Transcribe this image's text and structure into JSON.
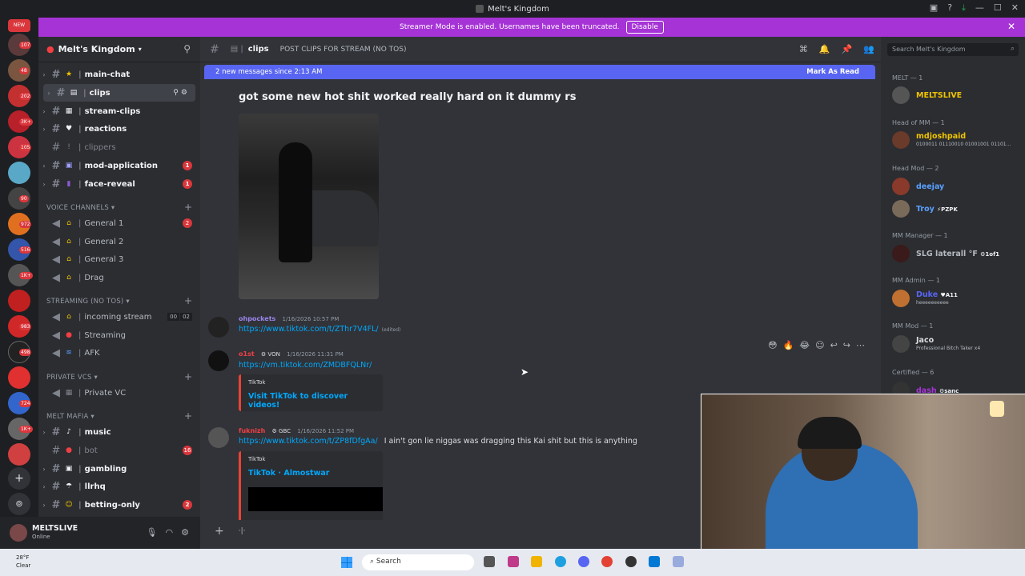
{
  "window": {
    "title": "Melt's Kingdom"
  },
  "banner": {
    "text": "Streamer Mode is enabled. Usernames have been truncated.",
    "disable_label": "Disable"
  },
  "servers": {
    "new_badge": "NEW",
    "badges": [
      "107",
      "48",
      "202",
      "3K+",
      "105",
      "90",
      "972",
      "516",
      "1K+",
      "983",
      "498",
      "724",
      "1K+"
    ]
  },
  "guild": {
    "name": "Melt's Kingdom"
  },
  "channels": [
    {
      "name": "main-chat",
      "icon": "star"
    },
    {
      "name": "clips",
      "icon": "clip",
      "active": true
    },
    {
      "name": "stream-clips",
      "icon": "video"
    },
    {
      "name": "reactions",
      "icon": "heart"
    },
    {
      "name": "clippers",
      "icon": "pin",
      "muted": true
    },
    {
      "name": "mod-application",
      "icon": "form",
      "unread": "1"
    },
    {
      "name": "face-reveal",
      "icon": "mask",
      "unread": "1"
    }
  ],
  "voice_category": "VOICE CHANNELS",
  "voice_channels": [
    {
      "name": "General 1",
      "unread": "2"
    },
    {
      "name": "General 2"
    },
    {
      "name": "General 3"
    },
    {
      "name": "Drag"
    }
  ],
  "streaming_category": "STREAMING (NO TOS)",
  "streaming_channels": [
    {
      "name": "incoming stream",
      "counts": [
        "00",
        "02"
      ]
    },
    {
      "name": "Streaming"
    },
    {
      "name": "AFK"
    }
  ],
  "private_category": "PRIVATE VCS",
  "private_channels": [
    {
      "name": "Private VC"
    }
  ],
  "mafia_category": "MELT MAFIA",
  "mafia_channels": [
    {
      "name": "music"
    },
    {
      "name": "bot",
      "unread": "16",
      "muted": true
    },
    {
      "name": "gambling"
    },
    {
      "name": "llrhq"
    },
    {
      "name": "betting-only",
      "unread": "2"
    }
  ],
  "user": {
    "name": "MELTSLIVE",
    "status": "Online"
  },
  "chat": {
    "channel": "clips",
    "topic": "POST CLIPS FOR STREAM (NO TOS)",
    "new_messages": "2 new messages since 2:13 AM",
    "mark_as_read": "Mark As Read",
    "big_text": "got some new hot shit worked really hard on it dummy rs",
    "messages": [
      {
        "user": "ohpockets",
        "time": "1/16/2026 10:57 PM",
        "link": "https://www.tiktok.com/t/ZThr7V4FL/",
        "edited": "(edited)",
        "color": "#9b84ec"
      },
      {
        "user": "o1st",
        "tag": "VON",
        "time": "1/16/2026 11:31 PM",
        "link": "https://vm.tiktok.com/ZMDBFQLNr/",
        "embed_provider": "TikTok",
        "embed_title": "Visit TikTok to discover videos!",
        "color": "#f23f43"
      },
      {
        "user": "fuknizh",
        "tag": "GBC",
        "time": "1/16/2026 11:52 PM",
        "link": "https://www.tiktok.com/t/ZP8fDfgAa/",
        "after": "I ain't gon lie niggas was dragging this Kai shit but this is anything",
        "embed_provider": "TikTok",
        "embed_title": "TikTok · Almostwar",
        "color": "#f23f43"
      }
    ],
    "reactions": [
      "😳",
      "🔥",
      "😂"
    ]
  },
  "members": {
    "search_placeholder": "Search Melt's Kingdom",
    "groups": [
      {
        "role": "MELT — 1",
        "members": [
          {
            "name": "MELTSLIVE",
            "color": "#f0c400"
          }
        ]
      },
      {
        "role": "Head of MM — 1",
        "members": [
          {
            "name": "mdjoshpaid",
            "sub": "0100011 01110010 01001001 01101...",
            "color": "#f0c400"
          }
        ]
      },
      {
        "role": "Head Mod — 2",
        "members": [
          {
            "name": "deejay",
            "color": "#5aa0ff"
          },
          {
            "name": "Troy",
            "tag": "PZPK",
            "color": "#5aa0ff"
          }
        ]
      },
      {
        "role": "MM Manager — 1",
        "members": [
          {
            "name": "SLG laterall °F",
            "tag": "1of1",
            "color": "#b5bac1"
          }
        ]
      },
      {
        "role": "MM Admin — 1",
        "members": [
          {
            "name": "Duke",
            "tag": "A11",
            "sub": "heeeeeeeeee",
            "color": "#5865f2"
          }
        ]
      },
      {
        "role": "MM Mod — 1",
        "members": [
          {
            "name": "Jaco",
            "sub": "Professional Bitch Taker x4",
            "color": "#b5bac1"
          }
        ]
      },
      {
        "role": "Certified — 6",
        "members": [
          {
            "name": "dash",
            "tag": "sanc",
            "color": "#a633d6"
          }
        ]
      }
    ]
  },
  "taskbar": {
    "temp": "28°F",
    "weather": "Clear",
    "search": "Search"
  }
}
